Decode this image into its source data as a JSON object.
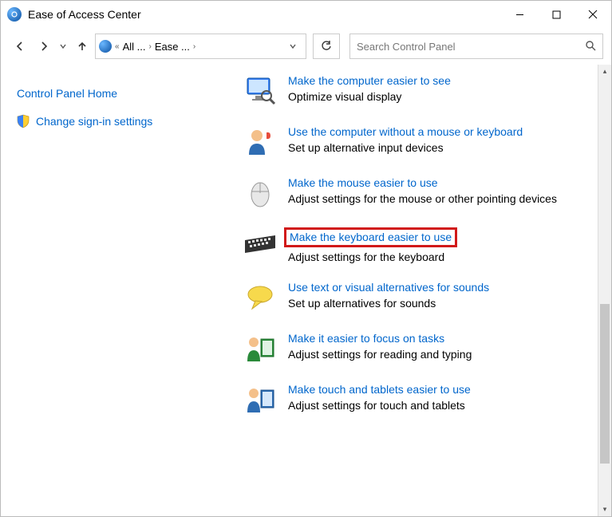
{
  "titlebar": {
    "title": "Ease of Access Center"
  },
  "breadcrumb": {
    "seg1": "All ...",
    "seg2": "Ease ..."
  },
  "search": {
    "placeholder": "Search Control Panel"
  },
  "sidebar": {
    "home": "Control Panel Home",
    "signin": "Change sign-in settings"
  },
  "items": [
    {
      "link": "Make the computer easier to see",
      "desc": "Optimize visual display"
    },
    {
      "link": "Use the computer without a mouse or keyboard",
      "desc": "Set up alternative input devices"
    },
    {
      "link": "Make the mouse easier to use",
      "desc": "Adjust settings for the mouse or other pointing devices"
    },
    {
      "link": "Make the keyboard easier to use",
      "desc": "Adjust settings for the keyboard"
    },
    {
      "link": "Use text or visual alternatives for sounds",
      "desc": "Set up alternatives for sounds"
    },
    {
      "link": "Make it easier to focus on tasks",
      "desc": "Adjust settings for reading and typing"
    },
    {
      "link": "Make touch and tablets easier to use",
      "desc": "Adjust settings for touch and tablets"
    }
  ]
}
